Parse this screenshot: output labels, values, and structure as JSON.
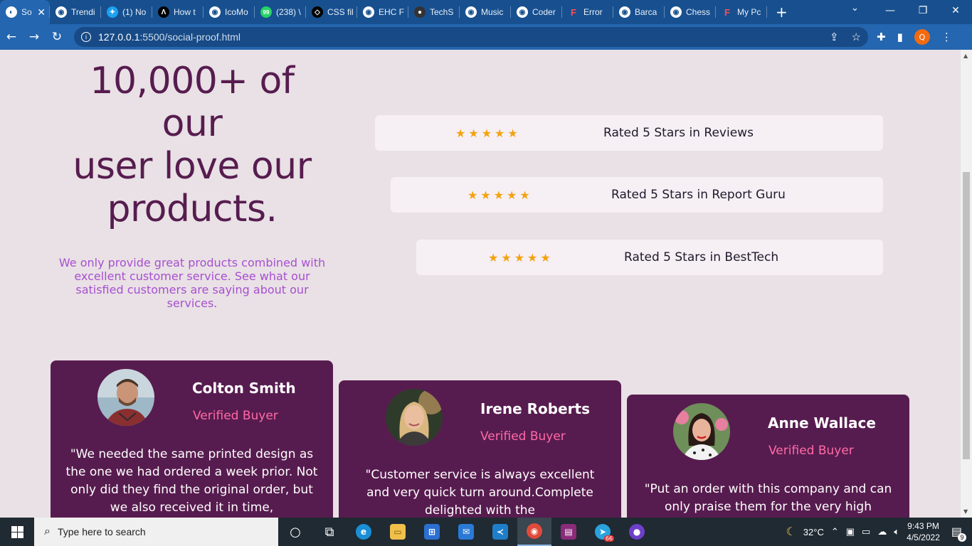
{
  "browser": {
    "tabs": [
      {
        "label": "So",
        "icon": "chrome-icon",
        "active": true
      },
      {
        "label": "Trendi",
        "icon": "globe-icon"
      },
      {
        "label": "(1) No",
        "icon": "twitter-icon"
      },
      {
        "label": "How t",
        "icon": "bracket-icon"
      },
      {
        "label": "IcoMo",
        "icon": "globe-icon"
      },
      {
        "label": "(238) \\",
        "icon": "whatsapp-icon"
      },
      {
        "label": "CSS fil",
        "icon": "codepen-icon"
      },
      {
        "label": "EHC F",
        "icon": "globe-icon"
      },
      {
        "label": "TechS",
        "icon": "github-icon"
      },
      {
        "label": "Music",
        "icon": "globe-icon"
      },
      {
        "label": "Coder",
        "icon": "globe-icon"
      },
      {
        "label": "Error",
        "icon": "figma-icon"
      },
      {
        "label": "Barca",
        "icon": "globe-icon"
      },
      {
        "label": "Chess",
        "icon": "globe-icon"
      },
      {
        "label": "My Pc",
        "icon": "figma-icon"
      }
    ],
    "url_host": "127.0.0.1",
    "url_path": ":5500/social-proof.html",
    "profile_initial": "Q"
  },
  "hero": {
    "heading_line1": "10,000+ of",
    "heading_line2": "our",
    "heading_line3": "user love our",
    "heading_line4": "products.",
    "subtext": "We only provide great products combined with excellent customer service. See what our satisfied customers are saying about our services."
  },
  "ratings": [
    {
      "stars": "★★★★★",
      "text": "Rated 5 Stars in Reviews"
    },
    {
      "stars": "★★★★★",
      "text": "Rated 5 Stars in Report Guru"
    },
    {
      "stars": "★★★★★",
      "text": "Rated 5 Stars in BestTech"
    }
  ],
  "testimonials": [
    {
      "name": "Colton Smith",
      "badge": "Verified Buyer",
      "quote": "\"We needed the same printed design as the one we had ordered a week prior. Not only did they find the original order, but we also received it in time,"
    },
    {
      "name": "Irene Roberts",
      "badge": "Verified Buyer",
      "quote": "\"Customer service is always excellent and very quick turn around.Complete delighted with the"
    },
    {
      "name": "Anne Wallace",
      "badge": "Verified Buyer",
      "quote": "\"Put an order with this company and can only praise them for the very high"
    }
  ],
  "taskbar": {
    "search_placeholder": "Type here to search",
    "weather": "32°C",
    "time": "9:43 PM",
    "date": "4/5/2022",
    "notification_count": "9",
    "telegram_badge": "66"
  },
  "colors": {
    "accent": "#571c4f",
    "verified": "#ff6aa6",
    "star": "#f2a30f",
    "subtext": "#a74fd1",
    "background": "#e9e1e5"
  }
}
